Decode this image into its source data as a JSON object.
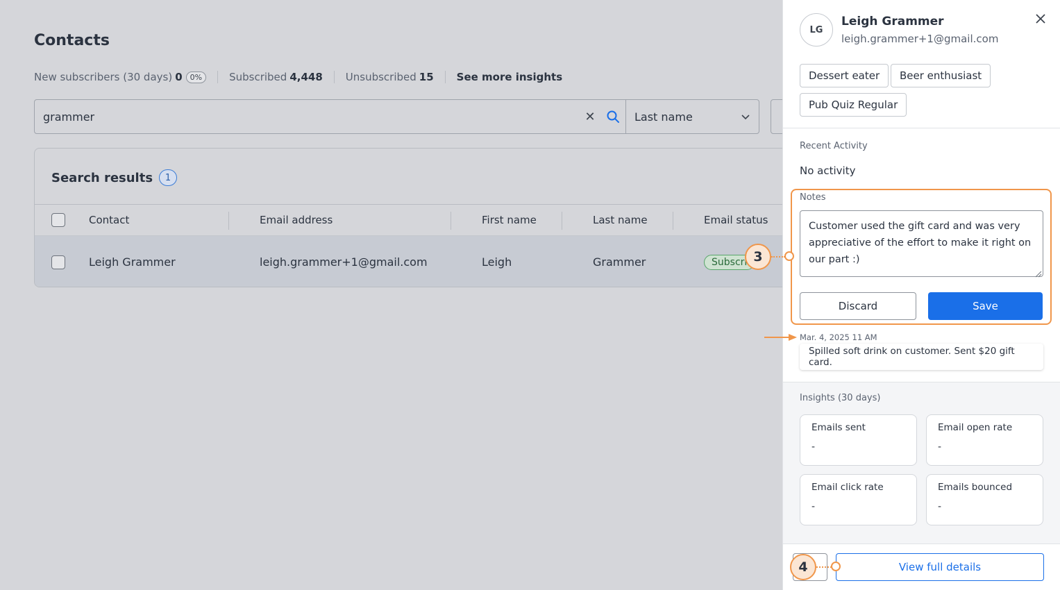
{
  "page": {
    "title": "Contacts"
  },
  "insights_bar": {
    "new_subscribers_label": "New subscribers (30 days)",
    "new_subscribers_count": "0",
    "new_subscribers_pct": "0%",
    "subscribed_label": "Subscribed",
    "subscribed_count": "4,448",
    "unsubscribed_label": "Unsubscribed",
    "unsubscribed_count": "15",
    "see_more_label": "See more insights"
  },
  "search": {
    "value": "grammer",
    "clear_icon": "close-icon",
    "search_icon": "search-icon"
  },
  "search_field_select": {
    "value": "Last name",
    "icon": "chevron-down-icon"
  },
  "results": {
    "title": "Search results",
    "count": "1",
    "columns": [
      "Contact",
      "Email address",
      "First name",
      "Last name",
      "Email status"
    ],
    "rows": [
      {
        "contact": "Leigh Grammer",
        "email": "leigh.grammer+1@gmail.com",
        "first_name": "Leigh",
        "last_name": "Grammer",
        "status": "Subscri"
      }
    ]
  },
  "panel": {
    "avatar_initials": "LG",
    "name": "Leigh Grammer",
    "email": "leigh.grammer+1@gmail.com",
    "tags": [
      "Dessert eater",
      "Beer enthusiast",
      "Pub Quiz Regular"
    ],
    "recent_activity_label": "Recent Activity",
    "recent_activity_value": "No activity",
    "notes_label": "Notes",
    "notes_draft": "Customer used the gift card and was very appreciative of the effort to make it right on our part :)",
    "discard_label": "Discard",
    "save_label": "Save",
    "saved_note": {
      "date": "Mar. 4, 2025 11 AM",
      "text": "Spilled soft drink on customer. Sent $20 gift card."
    },
    "insights_label": "Insights (30 days)",
    "metrics": [
      {
        "title": "Emails sent",
        "value": "-"
      },
      {
        "title": "Email open rate",
        "value": "-"
      },
      {
        "title": "Email click rate",
        "value": "-"
      },
      {
        "title": "Emails bounced",
        "value": "-"
      }
    ],
    "view_full_details_label": "View full details"
  },
  "annotations": {
    "step_3": "3",
    "step_4": "4"
  },
  "colors": {
    "accent": "#1a6fe8",
    "annotation": "#f0964a",
    "overlay": "#d5d6da",
    "subscribed": "#58a56a"
  }
}
